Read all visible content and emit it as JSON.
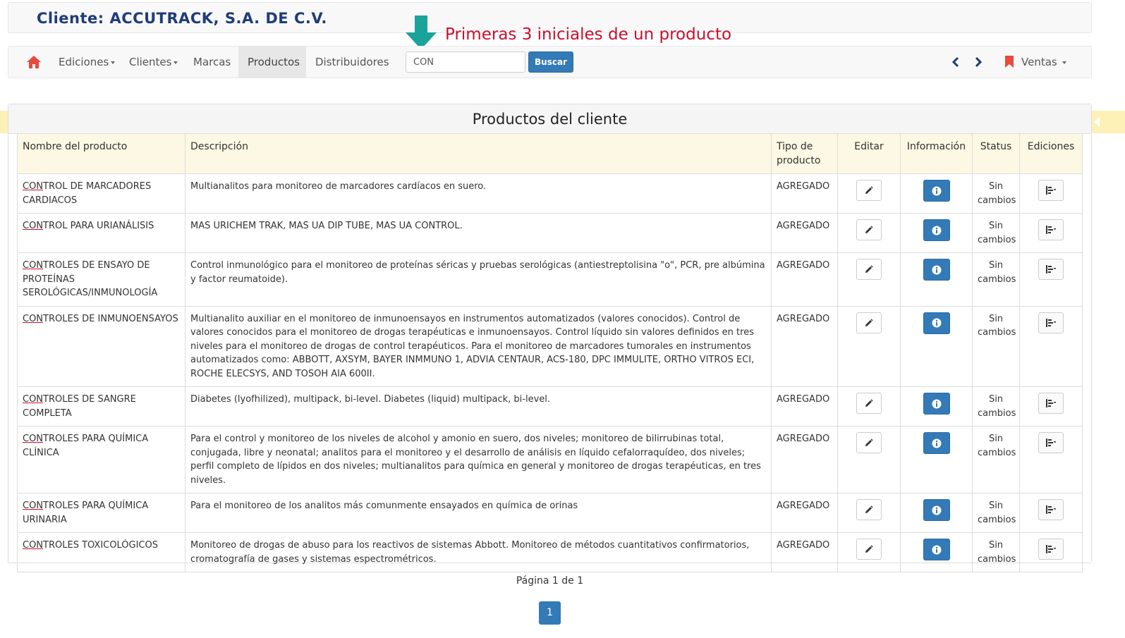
{
  "header": {
    "client_title": "Cliente: ACCUTRACK, S.A. DE C.V."
  },
  "annotation": {
    "text": "Primeras 3 iniciales de un producto"
  },
  "nav": {
    "items": [
      {
        "label": "Ediciones",
        "dropdown": true
      },
      {
        "label": "Clientes",
        "dropdown": true
      },
      {
        "label": "Marcas",
        "dropdown": false
      },
      {
        "label": "Productos",
        "dropdown": false,
        "active": true
      },
      {
        "label": "Distribuidores",
        "dropdown": false
      }
    ],
    "search_value": "CON",
    "search_button": "Buscar",
    "ventas": "Ventas"
  },
  "panel": {
    "title": "Productos del cliente"
  },
  "table": {
    "headers": [
      "Nombre del producto",
      "Descripción",
      "Tipo de producto",
      "Editar",
      "Información",
      "Status",
      "Ediciones"
    ],
    "rows": [
      {
        "prefix": "CON",
        "name": "TROL DE MARCADORES CARDIACOS",
        "description": "Multianalitos para monitoreo de marcadores cardíacos en suero.",
        "type": "AGREGADO",
        "status": "Sin cambios"
      },
      {
        "prefix": "CON",
        "name": "TROL PARA URIANÁLISIS",
        "description": "MAS URICHEM TRAK, MAS UA DIP TUBE, MAS UA CONTROL.",
        "type": "AGREGADO",
        "status": "Sin cambios"
      },
      {
        "prefix": "CON",
        "name": "TROLES DE ENSAYO DE PROTEÍNAS SEROLÓGICAS/INMUNOLOGÍA",
        "description": "Control inmunológico para el monitoreo de proteínas séricas y pruebas serológicas (antiestreptolisina \"o\", PCR, pre albúmina y factor reumatoide).",
        "type": "AGREGADO",
        "status": "Sin cambios"
      },
      {
        "prefix": "CON",
        "name": "TROLES DE INMUNOENSAYOS",
        "description": "Multianalito auxiliar en el monitoreo de inmunoensayos en instrumentos automatizados (valores conocidos). Control de valores conocidos para el monitoreo de drogas terapéuticas e inmunoensayos. Control líquido sin valores definidos en tres niveles para el monitoreo de drogas de control terapéuticos. Para el monitoreo de marcadores tumorales en instrumentos automatizados como: ABBOTT, AXSYM, BAYER INMMUNO 1, ADVIA CENTAUR, ACS-180, DPC IMMULITE, ORTHO VITROS ECI, ROCHE ELECSYS, AND TOSOH AIA 600II.",
        "type": "AGREGADO",
        "status": "Sin cambios"
      },
      {
        "prefix": "CON",
        "name": "TROLES DE SANGRE COMPLETA",
        "description": "Diabetes (lyofhilized), multipack, bi-level. Diabetes (liquid) multipack, bi-level.",
        "type": "AGREGADO",
        "status": "Sin cambios"
      },
      {
        "prefix": "CON",
        "name": "TROLES PARA QUÍMICA CLÍNICA",
        "description": "Para el control y monitoreo de los niveles de alcohol y amonio en suero, dos niveles; monitoreo de bilirrubinas total, conjugada, libre y neonatal; analitos para el monitoreo y el desarrollo de análisis en líquido cefalorraquídeo, dos niveles; perfil completo de lípidos en dos niveles; multianalitos para química en general y monitoreo de drogas terapéuticas, en tres niveles.",
        "type": "AGREGADO",
        "status": "Sin cambios"
      },
      {
        "prefix": "CON",
        "name": "TROLES PARA QUÍMICA URINARIA",
        "description": "Para el monitoreo de los analitos más comunmente ensayados en química de orinas",
        "type": "AGREGADO",
        "status": "Sin cambios"
      },
      {
        "prefix": "CON",
        "name": "TROLES TOXICOLÓGICOS",
        "description": "Monitoreo de drogas de abuso para los reactivos de sistemas Abbott. Monitoreo de métodos cuantitativos confirmatorios, cromatografía de gases y sistemas espectrométricos.",
        "type": "AGREGADO",
        "status": "Sin cambios"
      }
    ]
  },
  "pagination": {
    "text": "Página 1 de 1",
    "current_page": "1"
  },
  "colors": {
    "primary": "#337ab7",
    "annotation": "#c8102e",
    "arrow": "#1aa39a",
    "header_bg": "#fcf8e3",
    "title": "#1f3c7a"
  }
}
